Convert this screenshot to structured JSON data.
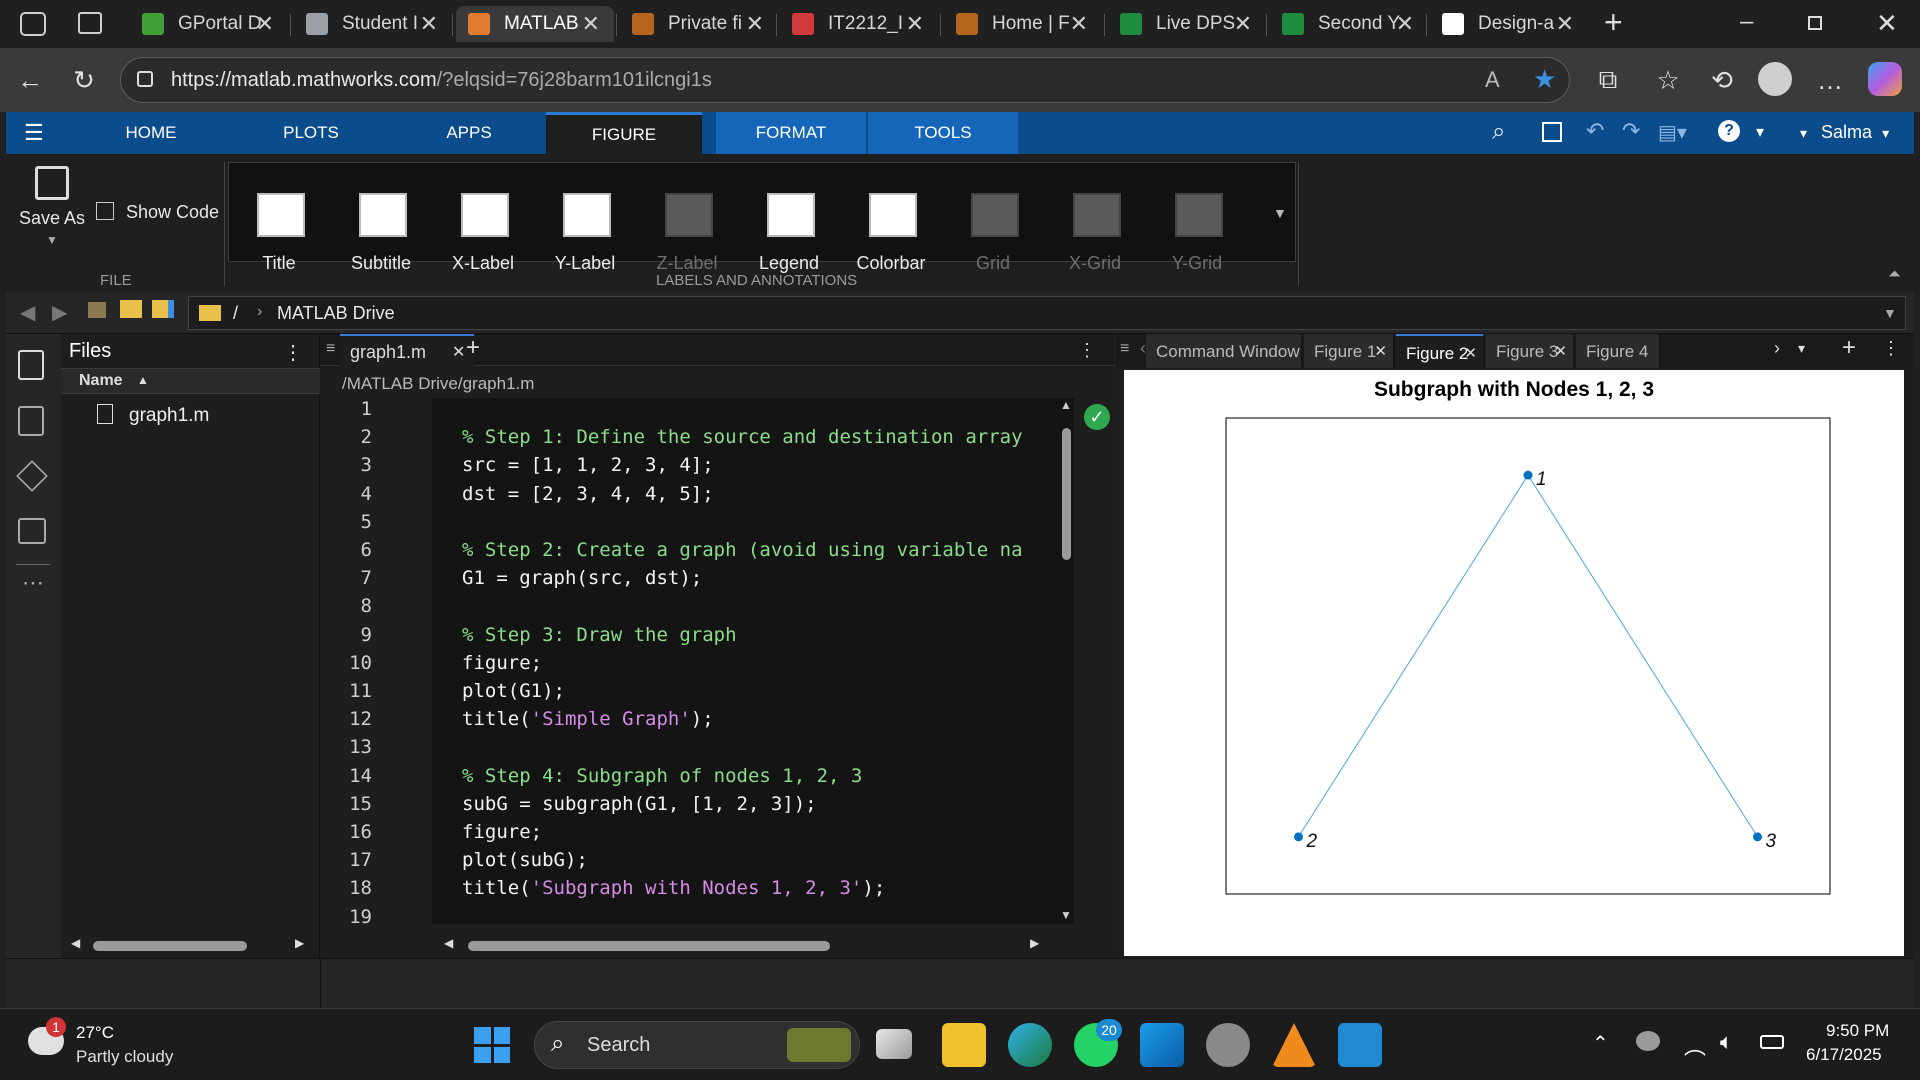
{
  "browser": {
    "tabs": [
      {
        "label": "GPortal D",
        "icon": "mongodb-leaf-icon",
        "color": "#3fa037"
      },
      {
        "label": "Student I",
        "icon": "globe-icon",
        "color": "#9aa0a6"
      },
      {
        "label": "MATLAB",
        "icon": "matlab-icon",
        "color": "#e07b2f",
        "active": true
      },
      {
        "label": "Private fi",
        "icon": "mathworks-icon",
        "color": "#b5651d"
      },
      {
        "label": "IT2212_I",
        "icon": "pdf-icon",
        "color": "#d23b3b"
      },
      {
        "label": "Home | F",
        "icon": "mathworks-icon",
        "color": "#b5651d"
      },
      {
        "label": "Live DPS",
        "icon": "sheets-icon",
        "color": "#1e8e3e"
      },
      {
        "label": "Second Y",
        "icon": "sheets-plus-icon",
        "color": "#1e8e3e"
      },
      {
        "label": "Design-a",
        "icon": "github-icon",
        "color": "#ffffff"
      }
    ],
    "url": "https://matlab.mathworks.com/?elqsid=76j28barm101ilcngi1s",
    "url_host": "https://matlab.mathworks.com",
    "url_rest": "/?elqsid=76j28barm101ilcngi1s"
  },
  "matlab": {
    "toolstrip_tabs": [
      "HOME",
      "PLOTS",
      "APPS",
      "FIGURE",
      "FORMAT",
      "TOOLS"
    ],
    "active_tab": "FIGURE",
    "user": "Salma",
    "file_section": {
      "save_as": "Save As",
      "show_code": "Show Code",
      "label": "FILE"
    },
    "labels_section": {
      "buttons": [
        {
          "label": "Title",
          "enabled": true
        },
        {
          "label": "Subtitle",
          "enabled": true
        },
        {
          "label": "X-Label",
          "enabled": true
        },
        {
          "label": "Y-Label",
          "enabled": true
        },
        {
          "label": "Z-Label",
          "enabled": false
        },
        {
          "label": "Legend",
          "enabled": true
        },
        {
          "label": "Colorbar",
          "enabled": true
        },
        {
          "label": "Grid",
          "enabled": false
        },
        {
          "label": "X-Grid",
          "enabled": false
        },
        {
          "label": "Y-Grid",
          "enabled": false
        }
      ],
      "label": "LABELS AND ANNOTATIONS"
    },
    "path": {
      "root": "/",
      "folder": "MATLAB Drive"
    },
    "files_panel": {
      "title": "Files",
      "column": "Name",
      "items": [
        "graph1.m"
      ]
    },
    "editor": {
      "tab": "graph1.m",
      "path": "/MATLAB Drive/graph1.m",
      "line_numbers": [
        "1",
        "2",
        "3",
        "4",
        "5",
        "6",
        "7",
        "8",
        "9",
        "10",
        "11",
        "12",
        "13",
        "14",
        "15",
        "16",
        "17",
        "18",
        "19"
      ],
      "lines": [
        {
          "t": ""
        },
        {
          "t": "% Step 1: Define the source and destination array",
          "c": "cm"
        },
        {
          "t": "src = [1, 1, 2, 3, 4];"
        },
        {
          "t": "dst = [2, 3, 4, 4, 5];"
        },
        {
          "t": ""
        },
        {
          "t": "% Step 2: Create a graph (avoid using variable na",
          "c": "cm"
        },
        {
          "t": "G1 = graph(src, dst);"
        },
        {
          "t": ""
        },
        {
          "t": "% Step 3: Draw the graph",
          "c": "cm"
        },
        {
          "t": "figure;"
        },
        {
          "t": "plot(G1);"
        },
        {
          "t": "title('Simple Graph');",
          "s": "'Simple Graph'"
        },
        {
          "t": ""
        },
        {
          "t": "% Step 4: Subgraph of nodes 1, 2, 3",
          "c": "cm"
        },
        {
          "t": "subG = subgraph(G1, [1, 2, 3]);"
        },
        {
          "t": "figure;"
        },
        {
          "t": "plot(subG);"
        },
        {
          "t": "title('Subgraph with Nodes 1, 2, 3');",
          "s": "'Subgraph with Nodes 1, 2, 3'"
        },
        {
          "t": ""
        }
      ]
    },
    "figure_panel": {
      "tabs": [
        "Command Window",
        "Figure 1",
        "Figure 2",
        "Figure 3",
        "Figure 4"
      ],
      "active_tab": "Figure 2",
      "title": "Subgraph with Nodes 1, 2, 3"
    }
  },
  "chart_data": {
    "type": "scatter",
    "title": "Subgraph with Nodes 1, 2, 3",
    "nodes": [
      {
        "label": "1",
        "x": 0.5,
        "y": 0.88
      },
      {
        "label": "2",
        "x": 0.12,
        "y": 0.12
      },
      {
        "label": "3",
        "x": 0.88,
        "y": 0.12
      }
    ],
    "edges": [
      [
        "1",
        "2"
      ],
      [
        "1",
        "3"
      ]
    ],
    "node_color": "#0072bd",
    "edge_color": "#4ea6dc",
    "grid": false
  },
  "taskbar": {
    "weather": {
      "temp": "27°C",
      "desc": "Partly cloudy",
      "badge": "1"
    },
    "search": "Search",
    "whatsapp_badge": "20",
    "time": "9:50 PM",
    "date": "6/17/2025"
  }
}
